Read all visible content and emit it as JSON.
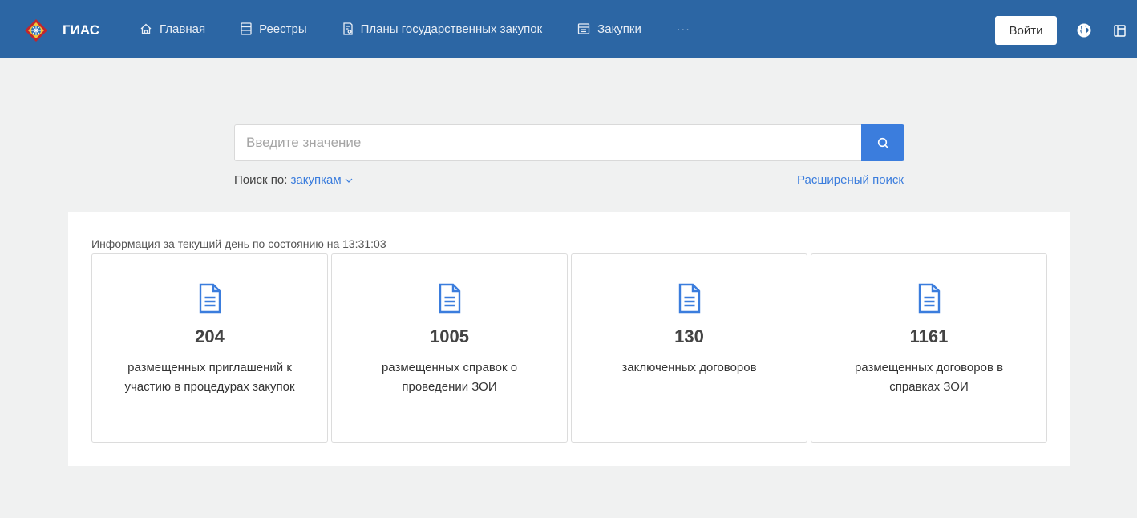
{
  "header": {
    "brand": "ГИАС",
    "nav": [
      {
        "label": "Главная",
        "icon": "home-icon"
      },
      {
        "label": "Реестры",
        "icon": "list-icon"
      },
      {
        "label": "Планы государственных закупок",
        "icon": "document-plan-icon"
      },
      {
        "label": "Закупки",
        "icon": "cart-register-icon"
      }
    ],
    "more": "···",
    "login_label": "Войти",
    "bg_color": "#2c66a4"
  },
  "search": {
    "placeholder": "Введите значение",
    "value": "",
    "search_by_prefix": "Поиск по:",
    "search_by_value": "закупкам",
    "advanced_label": "Расширеный поиск",
    "accent": "#3b7ddd"
  },
  "info": {
    "caption": "Информация за текущий день по состоянию на 13:31:03",
    "cards": [
      {
        "count": "204",
        "text": "размещенных приглашений к участию в процедурах закупок",
        "icon": "document-icon"
      },
      {
        "count": "1005",
        "text": "размещенных справок о проведении ЗОИ",
        "icon": "document-icon"
      },
      {
        "count": "130",
        "text": "заключенных договоров",
        "icon": "document-icon"
      },
      {
        "count": "1161",
        "text": "размещенных договоров в справках ЗОИ",
        "icon": "document-icon"
      }
    ]
  }
}
